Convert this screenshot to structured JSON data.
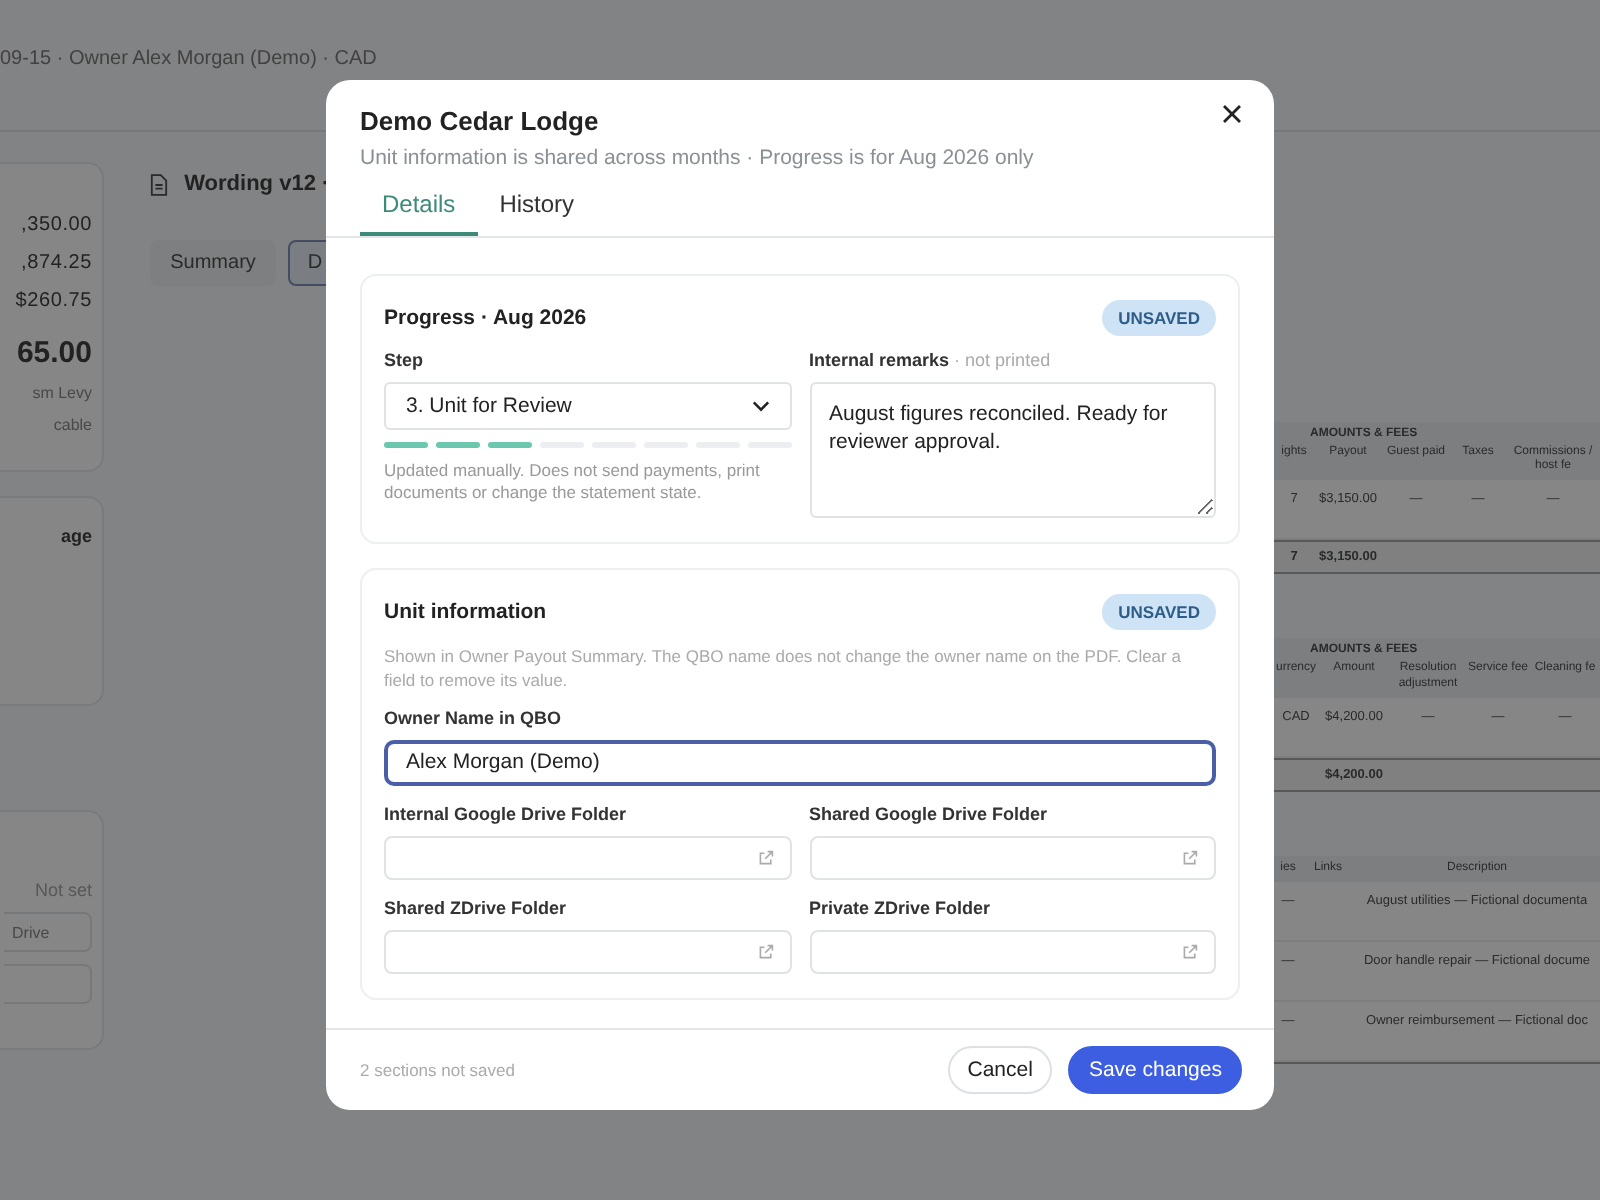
{
  "background": {
    "header_text": "09-15 · Owner Alex Morgan (Demo) · CAD",
    "summary_card": {
      "amounts": [
        ",350.00",
        ",874.25",
        "$260.75"
      ],
      "total": "65.00",
      "note_lines": [
        "sm Levy",
        "cable"
      ]
    },
    "manage_link": "age",
    "folders_card": {
      "status": "Not set",
      "inputs": [
        {
          "kind": "text",
          "placeholder": "Drive"
        },
        {
          "kind": "blank"
        }
      ]
    },
    "document": {
      "title": "Wording v12 ·",
      "tabs": [
        {
          "label": "Summary",
          "selected": false
        },
        {
          "label": "D",
          "selected": true
        }
      ]
    },
    "tables": [
      {
        "group": "AMOUNTS & FEES",
        "columns": [
          "ights",
          "Payout",
          "Guest paid",
          "Taxes",
          "Commissions / host fe"
        ],
        "rows": [
          [
            "7",
            "$3,150.00",
            "—",
            "—",
            "—"
          ]
        ],
        "total": {
          "column_1": "7",
          "column_2": "$3,150.00"
        }
      },
      {
        "group": "AMOUNTS & FEES",
        "columns": [
          "urrency",
          "Amount",
          "Resolution adjustment",
          "Service fee",
          "Cleaning fe"
        ],
        "rows": [
          [
            "CAD",
            "$4,200.00",
            "—",
            "—",
            "—"
          ]
        ],
        "total": {
          "column_2": "$4,200.00"
        }
      },
      {
        "columns": [
          "ies",
          "Links",
          "Description"
        ],
        "rows": [
          [
            "—",
            null,
            "August utilities — Fictional documenta"
          ],
          [
            "—",
            null,
            "Door handle repair — Fictional docume"
          ],
          [
            "—",
            null,
            "Owner reimbursement — Fictional doc"
          ]
        ]
      }
    ]
  },
  "modal": {
    "title": "Demo Cedar Lodge",
    "subtitle": "Unit information is shared across months · Progress is for Aug 2026 only",
    "tabs": [
      {
        "label": "Details",
        "selected": true
      },
      {
        "label": "History",
        "selected": false
      }
    ],
    "progress": {
      "title": "Progress · Aug 2026",
      "badge": "UNSAVED",
      "step_label": "Step",
      "step_value": "3. Unit for Review",
      "segments": [
        {
          "done": true
        },
        {
          "done": true
        },
        {
          "done": true
        },
        {
          "done": false
        },
        {
          "done": false
        },
        {
          "done": false
        },
        {
          "done": false
        },
        {
          "done": false
        }
      ],
      "hint": "Updated manually. Does not send payments, print documents or change the statement state.",
      "remarks_label": "Internal remarks",
      "remarks_note": "· not printed",
      "remarks_value": "August figures reconciled. Ready for reviewer approval."
    },
    "unit": {
      "title": "Unit information",
      "badge": "UNSAVED",
      "description": "Shown in Owner Payout Summary. The QBO name does not change the owner name on the PDF. Clear a field to remove its value.",
      "fields": [
        {
          "kind": "text",
          "label": "Owner Name in QBO",
          "value": "Alex Morgan (Demo)",
          "focused": true
        },
        {
          "kind": "link",
          "label": "Internal Google Drive Folder",
          "focused": false
        },
        {
          "kind": "link",
          "label": "Shared Google Drive Folder",
          "focused": false
        },
        {
          "kind": "link",
          "label": "Shared ZDrive Folder",
          "focused": false
        },
        {
          "kind": "link",
          "label": "Private ZDrive Folder",
          "focused": false
        }
      ]
    },
    "footer": {
      "status": "2 sections not saved",
      "buttons": [
        {
          "label": "Cancel",
          "kind": "secondary"
        },
        {
          "label": "Save changes",
          "kind": "primary"
        }
      ]
    }
  }
}
